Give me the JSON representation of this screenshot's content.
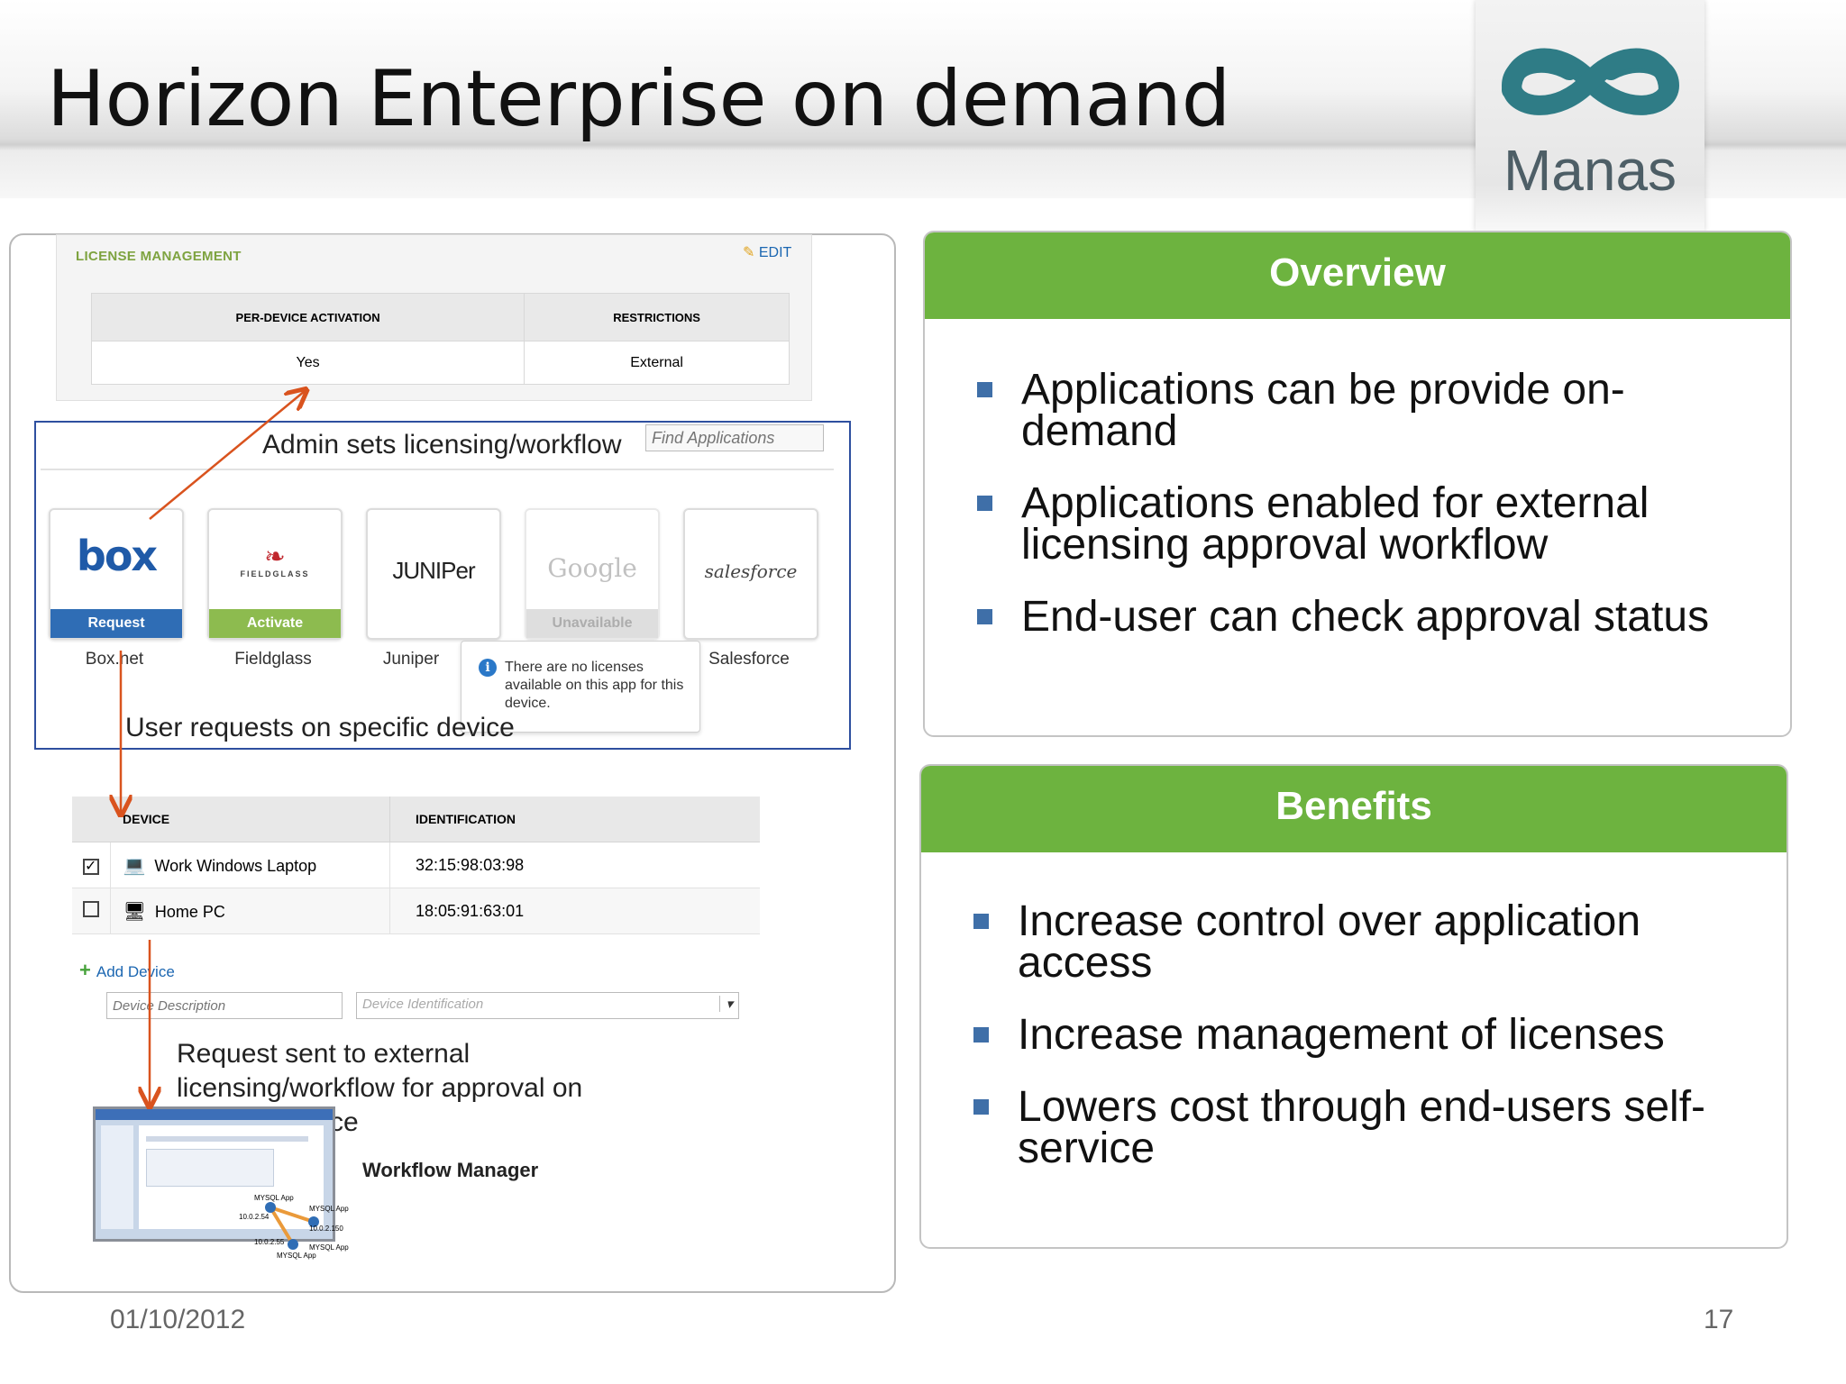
{
  "slide": {
    "title": "Horizon Enterprise on demand",
    "logo_text": "Manas",
    "date": "01/10/2012",
    "page_number": "17"
  },
  "license": {
    "title": "LICENSE MANAGEMENT",
    "edit_label": "EDIT",
    "columns": [
      "PER-DEVICE ACTIVATION",
      "RESTRICTIONS"
    ],
    "values": [
      "Yes",
      "External"
    ]
  },
  "apps_section": {
    "admin_label": "Admin sets licensing/workflow",
    "search_placeholder": "Find Applications",
    "apps": [
      {
        "logo": "box",
        "button": "Request",
        "name": "Box.net",
        "button_color": "#2f6db5"
      },
      {
        "logo": "FIELDGLASS",
        "button": "Activate",
        "name": "Fieldglass",
        "button_color": "#8dbb4f"
      },
      {
        "logo": "JUNIPer",
        "button": "",
        "name": "Juniper",
        "button_color": ""
      },
      {
        "logo": "Google",
        "button": "Unavailable",
        "name": "",
        "button_color": "#c9c9c9"
      },
      {
        "logo": "salesforce",
        "button": "",
        "name": "Salesforce",
        "button_color": ""
      }
    ],
    "tooltip": "There are no licenses available on this app for this device.",
    "user_label": "User requests on specific device"
  },
  "devices": {
    "columns": [
      "DEVICE",
      "IDENTIFICATION"
    ],
    "rows": [
      {
        "checked": true,
        "name": "Work Windows Laptop",
        "id": "32:15:98:03:98"
      },
      {
        "checked": false,
        "name": "Home PC",
        "id": "18:05:91:63:01"
      }
    ],
    "add_label": "Add Device",
    "desc_placeholder": "Device Description",
    "id_placeholder": "Device Identification"
  },
  "workflow": {
    "request_text_1": "Request sent to external",
    "request_text_2": "licensing/workflow for approval on",
    "request_text_3": "ce",
    "manager_label": "Workflow Manager",
    "nodes": [
      "MYSQL App",
      "MYSQL App",
      "10.0.2.54",
      "10.0.2.150",
      "10.0.2.55",
      "MYSQL App",
      "MYSQL App"
    ]
  },
  "overview": {
    "heading": "Overview",
    "items": [
      "Applications can be provide on-demand",
      "Applications enabled for external licensing approval workflow",
      "End-user can check approval status"
    ]
  },
  "benefits": {
    "heading": "Benefits",
    "items": [
      "Increase control over application access",
      "Increase management of licenses",
      "Lowers cost through end-users self-service"
    ]
  },
  "colors": {
    "accent_green": "#6db33f",
    "bullet_blue": "#3f6fa8",
    "frame_blue": "#2e4f9f",
    "arrow_orange": "#d9531e"
  }
}
